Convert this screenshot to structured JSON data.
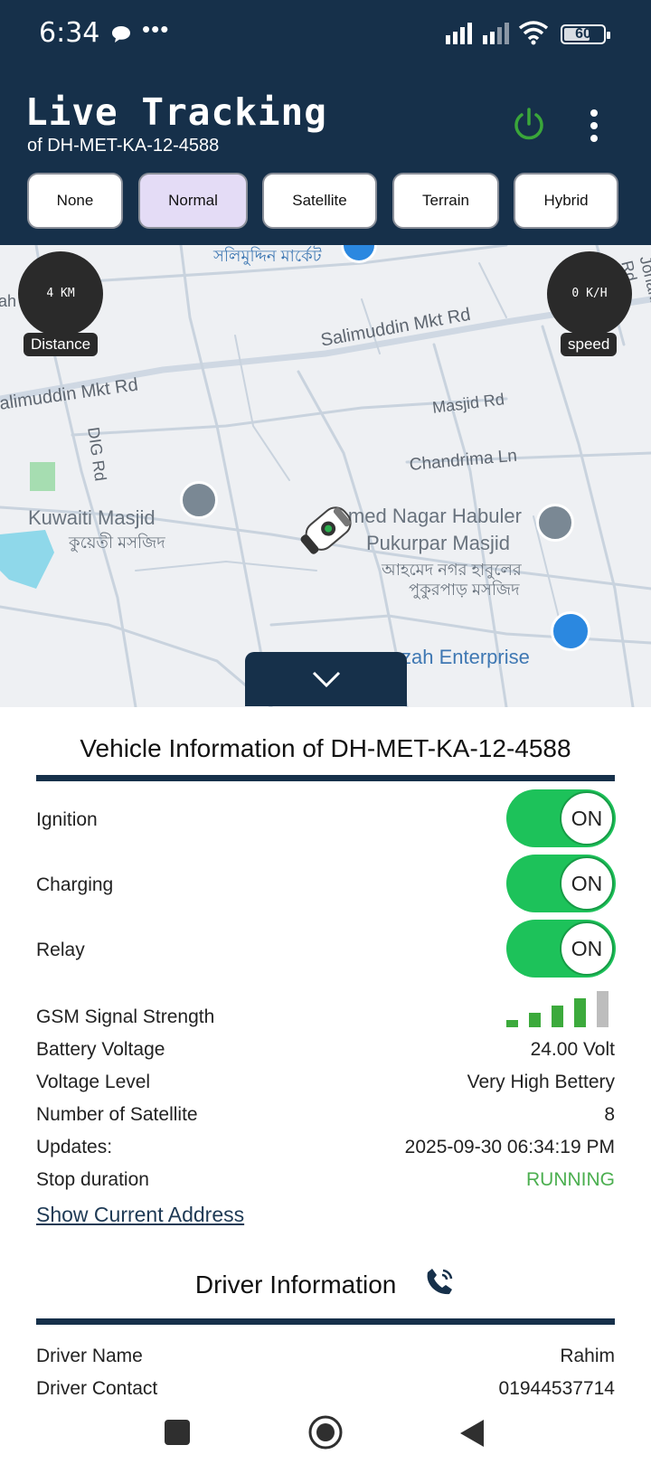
{
  "status_bar": {
    "time": "6:34",
    "dots": "•••",
    "battery": "60"
  },
  "header": {
    "title": "Live Tracking",
    "subtitle": "of DH-MET-KA-12-4588"
  },
  "map_types": [
    {
      "label": "None"
    },
    {
      "label": "Normal",
      "active": true
    },
    {
      "label": "Satellite"
    },
    {
      "label": "Terrain"
    },
    {
      "label": "Hybrid"
    }
  ],
  "map": {
    "distance_value": "4 KM",
    "distance_label": "Distance",
    "speed_value": "0 K/H",
    "speed_label": "speed",
    "labels": {
      "market_bn": "সলিমুদ্দিন মার্কেট",
      "salimuddin_rd_1": "Salimuddin Mkt Rd",
      "salimuddin_rd_2": "alimuddin Mkt Rd",
      "masjid_rd": "Masjid Rd",
      "chandrima": "Chandrima Ln",
      "dig_rd": "DIG Rd",
      "kuwaiti": "Kuwaiti Masjid",
      "kuwaiti_bn": "কুয়েতী মসজিদ",
      "ahmed_1": "Ahmed Nagar Habuler",
      "ahmed_2": "Pukurpar Masjid",
      "ahmed_bn_1": "আহমেদ নগর হাবুলের",
      "ahmed_bn_2": "পুকুরপাড় মসজিদ",
      "enterprise": "zah Enterprise",
      "jonaki": "Jonaki Rd",
      "edge_ah": "ah"
    }
  },
  "vehicle": {
    "title": "Vehicle Information of DH-MET-KA-12-4588",
    "ignition_label": "Ignition",
    "ignition_state": "ON",
    "charging_label": "Charging",
    "charging_state": "ON",
    "relay_label": "Relay",
    "relay_state": "ON",
    "gsm_label": "GSM Signal Strength",
    "gsm_level": 4,
    "gsm_max": 5,
    "battery_label": "Battery Voltage",
    "battery_value": "24.00 Volt",
    "voltage_label": "Voltage Level",
    "voltage_value": "Very High Bettery",
    "sat_label": "Number of Satellite",
    "sat_value": "8",
    "updates_label": "Updates:",
    "updates_value": "2025-09-30 06:34:19 PM",
    "stop_label": "Stop duration",
    "stop_value": "RUNNING",
    "address_link": "Show Current Address"
  },
  "driver": {
    "title": "Driver Information",
    "name_label": "Driver Name",
    "name_value": "Rahim",
    "contact_label": "Driver Contact",
    "contact_value": "01944537714"
  },
  "colors": {
    "header": "#16304a",
    "toggle_on": "#1dc25a",
    "running": "#4caf50",
    "power": "#3aa63a"
  }
}
